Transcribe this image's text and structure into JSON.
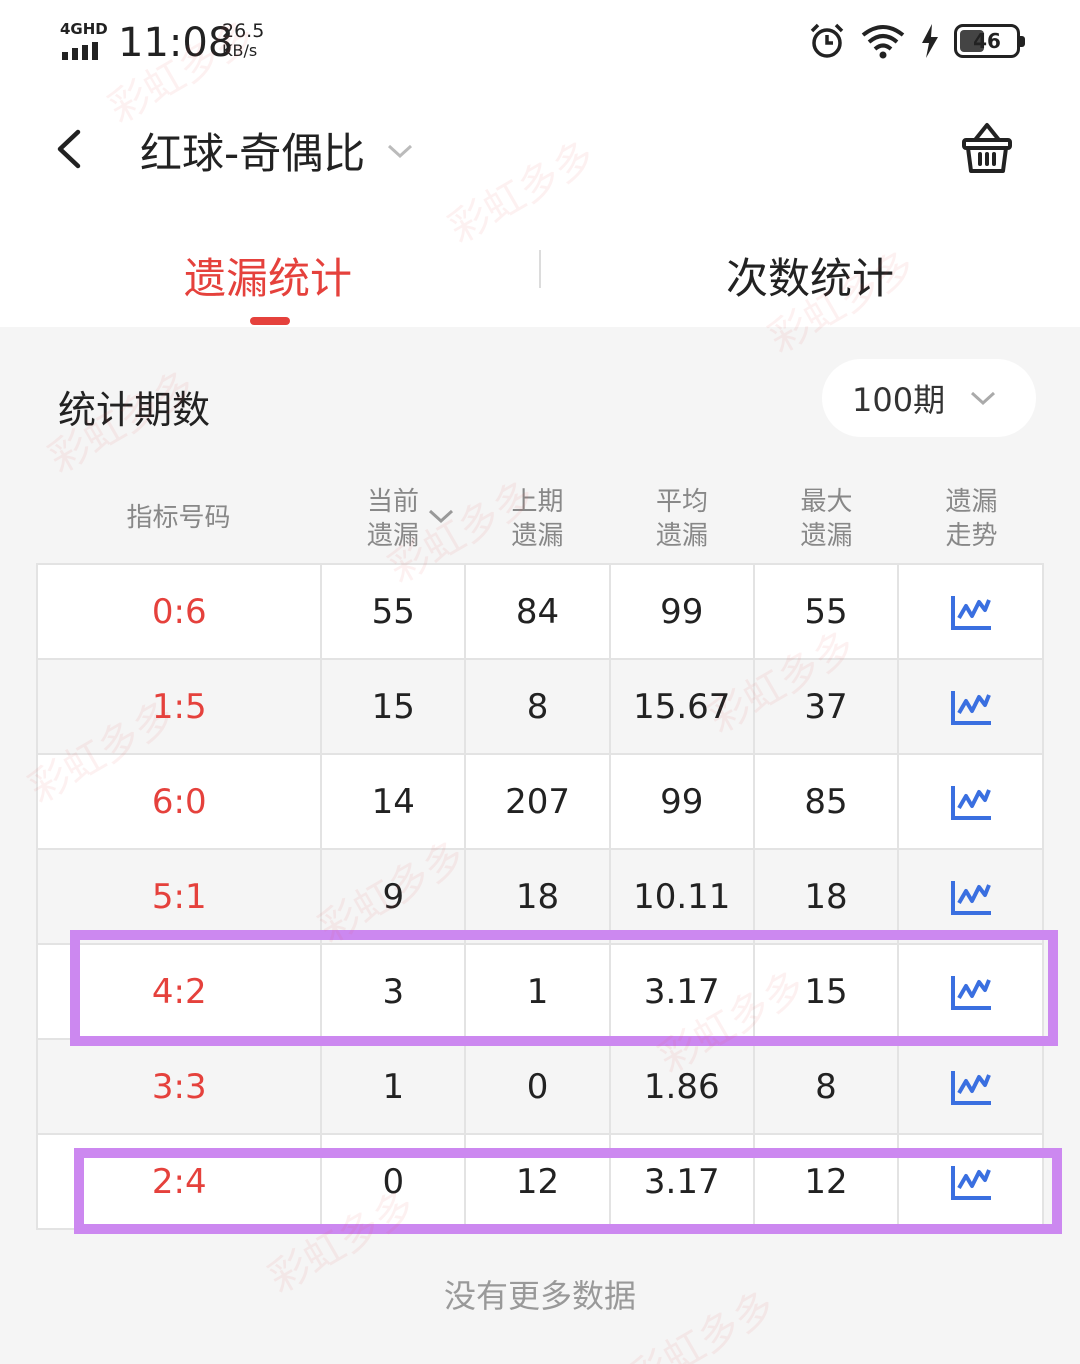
{
  "status_bar": {
    "network": "4GHD",
    "time": "11:08",
    "speed_value": "26.5",
    "speed_unit": "KB/s",
    "battery": "46",
    "icons": [
      "alarm-icon",
      "wifi-icon",
      "charging-icon",
      "battery-icon"
    ]
  },
  "header": {
    "title": "红球-奇偶比",
    "back_icon": "chevron-left-icon",
    "dropdown_icon": "chevron-down-icon",
    "cart_icon": "basket-icon"
  },
  "tabs": [
    {
      "label": "遗漏统计",
      "active": true
    },
    {
      "label": "次数统计",
      "active": false
    }
  ],
  "period": {
    "label": "统计期数",
    "value": "100期"
  },
  "table": {
    "headers": [
      {
        "line1": "指标号码",
        "line2": ""
      },
      {
        "line1": "当前",
        "line2": "遗漏"
      },
      {
        "line1": "上期",
        "line2": "遗漏"
      },
      {
        "line1": "平均",
        "line2": "遗漏"
      },
      {
        "line1": "最大",
        "line2": "遗漏"
      },
      {
        "line1": "遗漏",
        "line2": "走势"
      }
    ],
    "rows": [
      {
        "code": "0:6",
        "current": "55",
        "last": "84",
        "avg": "99",
        "max": "55",
        "highlighted": false
      },
      {
        "code": "1:5",
        "current": "15",
        "last": "8",
        "avg": "15.67",
        "max": "37",
        "highlighted": false
      },
      {
        "code": "6:0",
        "current": "14",
        "last": "207",
        "avg": "99",
        "max": "85",
        "highlighted": false
      },
      {
        "code": "5:1",
        "current": "9",
        "last": "18",
        "avg": "10.11",
        "max": "18",
        "highlighted": false
      },
      {
        "code": "4:2",
        "current": "3",
        "last": "1",
        "avg": "3.17",
        "max": "15",
        "highlighted": true
      },
      {
        "code": "3:3",
        "current": "1",
        "last": "0",
        "avg": "1.86",
        "max": "8",
        "highlighted": false
      },
      {
        "code": "2:4",
        "current": "0",
        "last": "12",
        "avg": "3.17",
        "max": "12",
        "highlighted": true
      }
    ],
    "trend_icon": "trend-chart-icon"
  },
  "footer_text": "没有更多数据",
  "colors": {
    "accent": "#e5413c",
    "trend_icon": "#3a6fe0",
    "highlight": "#cc88f0"
  },
  "watermark": "彩虹多多"
}
